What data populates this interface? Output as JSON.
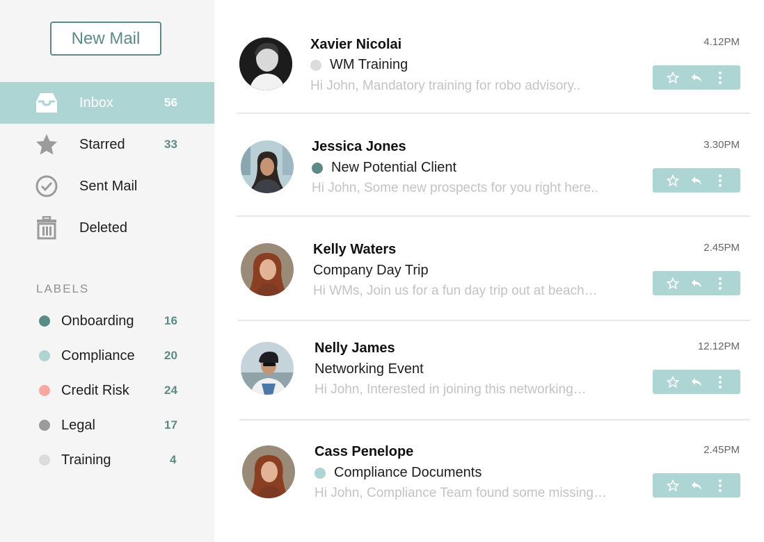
{
  "sidebar": {
    "new_mail_label": "New Mail",
    "nav": [
      {
        "label": "Inbox",
        "count": "56",
        "icon": "inbox-icon",
        "active": true
      },
      {
        "label": "Starred",
        "count": "33",
        "icon": "star-icon"
      },
      {
        "label": "Sent Mail",
        "count": "",
        "icon": "check-circle-icon"
      },
      {
        "label": "Deleted",
        "count": "",
        "icon": "trash-icon"
      }
    ],
    "labels_heading": "LABELS",
    "labels": [
      {
        "name": "Onboarding",
        "count": "16",
        "color": "#5b8b86"
      },
      {
        "name": "Compliance",
        "count": "20",
        "color": "#add5d3"
      },
      {
        "name": "Credit Risk",
        "count": "24",
        "color": "#f7a8a0"
      },
      {
        "name": "Legal",
        "count": "17",
        "color": "#9b9b9b"
      },
      {
        "name": "Training",
        "count": "4",
        "color": "#dcdcdc"
      }
    ]
  },
  "mails": [
    {
      "sender": "Xavier Nicolai",
      "subject": "WM Training",
      "label_color": "#dcdcdc",
      "preview": "Hi John, Mandatory training for  robo advisory..",
      "time": "4.12PM"
    },
    {
      "sender": "Jessica Jones",
      "subject": "New Potential Client",
      "label_color": "#5b8b86",
      "preview": "Hi John, Some new prospects for you right here..",
      "time": "3.30PM"
    },
    {
      "sender": "Kelly Waters",
      "subject": "Company Day Trip",
      "label_color": "",
      "preview": "Hi WMs, Join us for a fun day trip out at beach…",
      "time": "2.45PM"
    },
    {
      "sender": "Nelly James",
      "subject": "Networking Event",
      "label_color": "",
      "preview": "Hi John, Interested in joining this networking…",
      "time": "12.12PM"
    },
    {
      "sender": "Cass Penelope",
      "subject": "Compliance Documents",
      "label_color": "#add5d3",
      "preview": "Hi John, Compliance Team found some missing…",
      "time": "2.45PM"
    }
  ],
  "colors": {
    "accent": "#add5d3",
    "brand": "#5b8b86"
  }
}
